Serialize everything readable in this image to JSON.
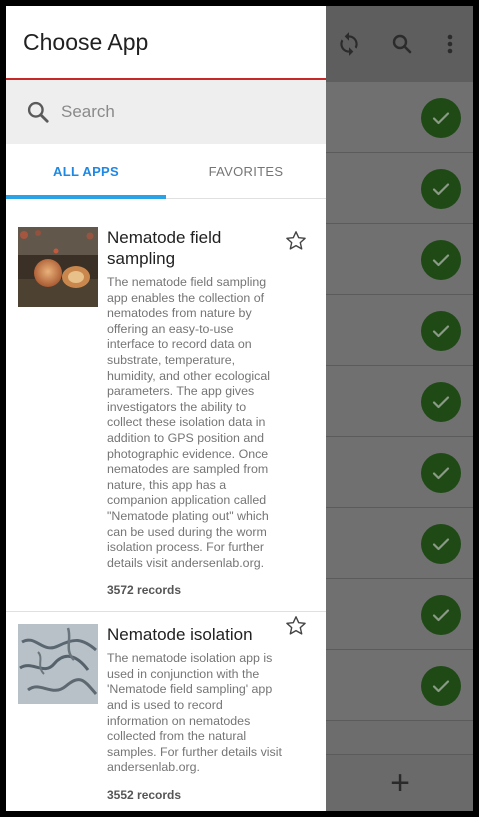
{
  "drawer": {
    "title": "Choose App",
    "search": {
      "placeholder": "Search"
    },
    "tabs": [
      {
        "label": "ALL APPS",
        "active": true
      },
      {
        "label": "FAVORITES",
        "active": false
      }
    ],
    "apps": [
      {
        "title": "Nematode field sampling",
        "description": "The nematode field sampling app enables the collection of nematodes from nature by offering an easy-to-use interface to record data on substrate, temperature, humidity, and other ecological parameters. The app gives investigators the ability to collect these isolation data in addition to GPS position and photographic evidence. Once nematodes are sampled from nature, this app has a companion application called \"Nematode plating out\" which can be used during the worm isolation process. For further details visit andersenlab.org.",
        "records": "3572 records",
        "thumbnail_icon": "fruit-photo-thumbnail",
        "favorite_icon": "star-outline-icon"
      },
      {
        "title": "Nematode isolation",
        "description": "The nematode isolation app is used in conjunction with the 'Nematode field sampling' app and is used to record information on nematodes collected from the natural samples. For further details visit andersenlab.org.",
        "records": "3552 records",
        "thumbnail_icon": "worms-photo-thumbnail",
        "favorite_icon": "star-outline-icon"
      }
    ]
  },
  "background": {
    "toolbar_icons": [
      "sync-icon",
      "search-icon",
      "more-vert-icon"
    ],
    "row_count": 9,
    "row_status_icon": "check-circle-icon",
    "fab_icon": "plus-icon"
  },
  "colors": {
    "accent": "#1e88e5",
    "tab_indicator": "#29a3e6",
    "header_divider": "#c62828",
    "check_bg": "#1f4a16"
  }
}
